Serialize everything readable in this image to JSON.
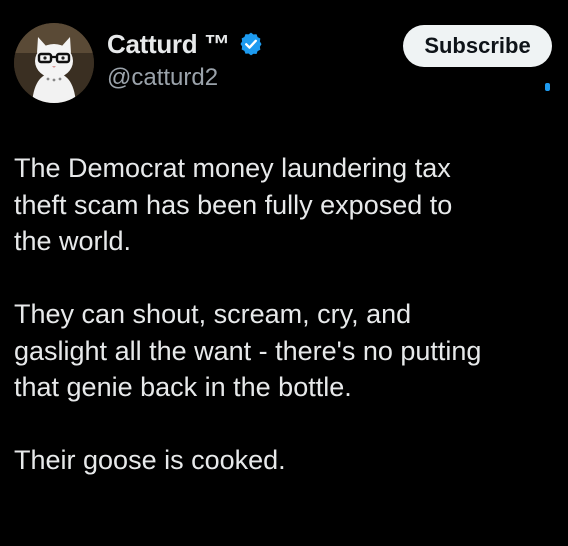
{
  "author": {
    "display_name": "Catturd ™",
    "handle": "@catturd2",
    "verified": true,
    "avatar_icon": "cat-with-glasses-avatar"
  },
  "actions": {
    "subscribe_label": "Subscribe"
  },
  "post": {
    "paragraphs": [
      "The Democrat money laundering tax\ntheft scam has been fully exposed to\nthe world.",
      "They can shout, scream, cry, and\ngaslight all the want - there's no putting\nthat genie back in the bottle.",
      "Their goose is cooked."
    ]
  },
  "colors": {
    "background": "#000000",
    "text": "#e7e9ea",
    "secondary_text": "#9ba3ab",
    "verified_blue": "#1d9bf0",
    "button_bg": "#eff3f4"
  }
}
